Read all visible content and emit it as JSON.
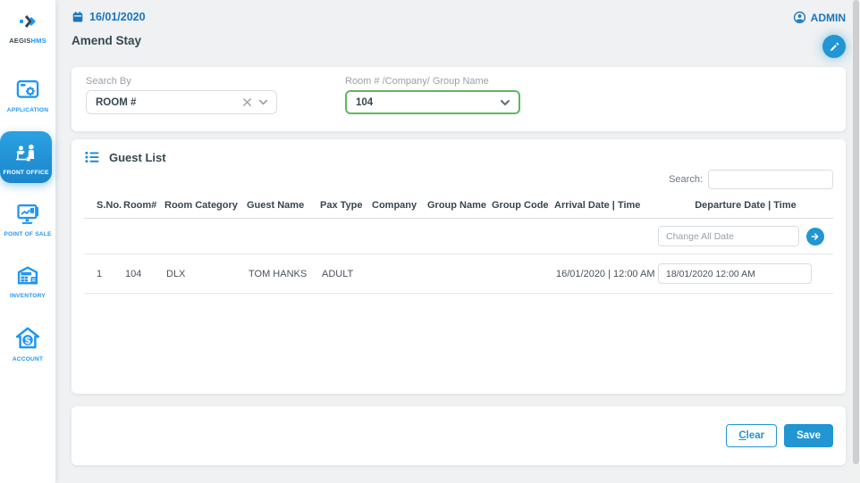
{
  "colors": {
    "primary_blue": "#2196d3",
    "sidebar_blue": "#2196f3",
    "header_text_blue": "#1b75bb",
    "active_gradient_top": "#2aa1e2",
    "active_gradient_bottom": "#1c86cb",
    "green_border": "#5cb860",
    "page_bg": "#eff1f2",
    "dark_text": "#37474f"
  },
  "sidebar": {
    "logo": {
      "brand_dark": "AEGIS",
      "brand_accent": "HMS"
    },
    "items": [
      {
        "label": "APPLICATION",
        "icon": "application-window-gear-icon",
        "active": false
      },
      {
        "label": "FRONT OFFICE",
        "icon": "front-desk-people-icon",
        "active": true
      },
      {
        "label": "POINT OF SALE",
        "icon": "pos-monitor-icon",
        "active": false
      },
      {
        "label": "INVENTORY",
        "icon": "warehouse-icon",
        "active": false
      },
      {
        "label": "ACCOUNT",
        "icon": "house-dollar-icon",
        "active": false
      }
    ]
  },
  "header": {
    "date": "16/01/2020",
    "user": "ADMIN",
    "page_title": "Amend Stay"
  },
  "search_panel": {
    "search_by_label": "Search By",
    "search_by_value": "ROOM #",
    "target_label": "Room # /Company/ Group Name",
    "target_value": "104"
  },
  "guest_list": {
    "title": "Guest List",
    "search_label": "Search:",
    "search_value": "",
    "columns": [
      "S.No.",
      "Room#",
      "Room Category",
      "Guest Name",
      "Pax Type",
      "Company",
      "Group Name",
      "Group Code",
      "Arrival Date | Time",
      "Departure Date | Time"
    ],
    "change_all_placeholder": "Change All Date",
    "rows": [
      {
        "sno": "1",
        "room": "104",
        "category": "DLX",
        "guest": "TOM HANKS",
        "pax": "ADULT",
        "company": "",
        "group_name": "",
        "group_code": "",
        "arrival": "16/01/2020 | 12:00 AM",
        "departure": "18/01/2020 12:00 AM"
      }
    ]
  },
  "footer": {
    "clear_accesskey": "C",
    "clear_rest": "lear",
    "save_label": "Save"
  }
}
